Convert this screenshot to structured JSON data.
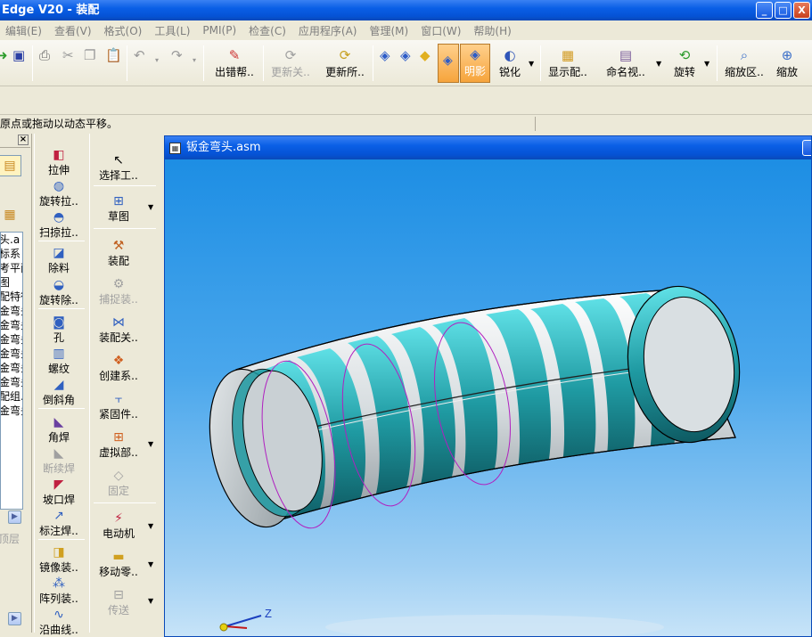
{
  "window": {
    "title": "Edge V20 - 装配",
    "min": "_",
    "max": "□",
    "close": "X"
  },
  "menu": [
    "编辑(E)",
    "查看(V)",
    "格式(O)",
    "工具(L)",
    "PMI(P)",
    "检查(C)",
    "应用程序(A)",
    "管理(M)",
    "窗口(W)",
    "帮助(H)"
  ],
  "toolbar": {
    "error_assistant": "出错帮..",
    "update_relations": "更新关..",
    "update_all": "更新所..",
    "shading": "明影",
    "sharpen": "锐化",
    "show_config": "显示配..",
    "named_view": "命名视..",
    "rotate": "旋转",
    "zoom_area": "缩放区..",
    "zoom": "缩放"
  },
  "status": {
    "prompt": "原点或拖动以动态平移。"
  },
  "tree": {
    "items": [
      "头.a",
      "标系",
      "考平面",
      "图",
      "配特征",
      "金弯头",
      "金弯头",
      "金弯头",
      "金弯头",
      "金弯头",
      "金弯头",
      "配组..",
      "金弯头"
    ],
    "footer": "顶层"
  },
  "commands_left": [
    "拉伸",
    "旋转拉..",
    "扫掠拉..",
    "除料",
    "旋转除..",
    "孔",
    "螺纹",
    "倒斜角",
    "角焊",
    "断续焊",
    "坡口焊",
    "标注焊..",
    "镜像装..",
    "阵列装..",
    "沿曲线.."
  ],
  "commands_right": [
    "选择工..",
    "草图",
    "装配",
    "捕捉装..",
    "装配关..",
    "创建系..",
    "紧固件..",
    "虚拟部..",
    "固定",
    "电动机",
    "移动零..",
    "传送"
  ],
  "document": {
    "title": "钣金弯头.asm",
    "axis_label": "Z"
  },
  "colors": {
    "teal": "#1f9aa2",
    "band_light": "#d7dde0",
    "background_top": "#1d8ee4",
    "background_bottom": "#c8e4f8"
  }
}
